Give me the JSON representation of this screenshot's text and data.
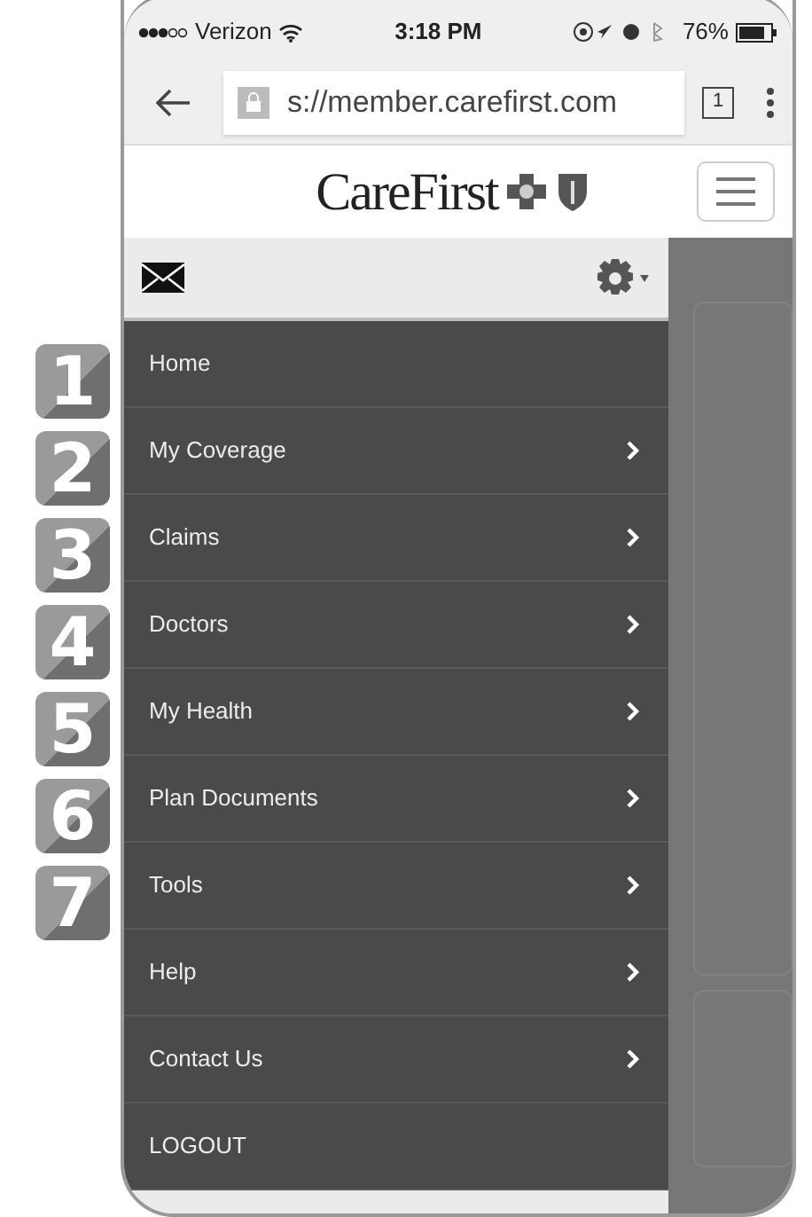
{
  "status_bar": {
    "carrier": "Verizon",
    "time": "3:18 PM",
    "battery": "76%"
  },
  "browser": {
    "url": "s://member.carefirst.com",
    "tab_count": "1"
  },
  "header": {
    "logo": "CareFirst"
  },
  "menu": [
    {
      "label": "Home",
      "has_arrow": false
    },
    {
      "label": "My Coverage",
      "has_arrow": true
    },
    {
      "label": "Claims",
      "has_arrow": true
    },
    {
      "label": "Doctors",
      "has_arrow": true
    },
    {
      "label": "My Health",
      "has_arrow": true
    },
    {
      "label": "Plan Documents",
      "has_arrow": true
    },
    {
      "label": "Tools",
      "has_arrow": true
    },
    {
      "label": "Help",
      "has_arrow": true
    },
    {
      "label": "Contact Us",
      "has_arrow": true
    },
    {
      "label": "LOGOUT",
      "has_arrow": false
    }
  ],
  "callouts": [
    "1",
    "2",
    "3",
    "4",
    "5",
    "6",
    "7"
  ]
}
